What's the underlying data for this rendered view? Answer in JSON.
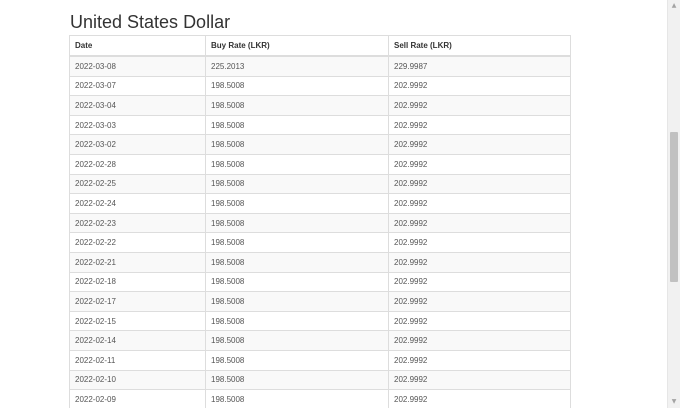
{
  "page": {
    "title": "United States Dollar"
  },
  "table": {
    "headers": [
      "Date",
      "Buy Rate (LKR)",
      "Sell Rate (LKR)"
    ],
    "rows": [
      [
        "2022-03-08",
        "225.2013",
        "229.9987"
      ],
      [
        "2022-03-07",
        "198.5008",
        "202.9992"
      ],
      [
        "2022-03-04",
        "198.5008",
        "202.9992"
      ],
      [
        "2022-03-03",
        "198.5008",
        "202.9992"
      ],
      [
        "2022-03-02",
        "198.5008",
        "202.9992"
      ],
      [
        "2022-02-28",
        "198.5008",
        "202.9992"
      ],
      [
        "2022-02-25",
        "198.5008",
        "202.9992"
      ],
      [
        "2022-02-24",
        "198.5008",
        "202.9992"
      ],
      [
        "2022-02-23",
        "198.5008",
        "202.9992"
      ],
      [
        "2022-02-22",
        "198.5008",
        "202.9992"
      ],
      [
        "2022-02-21",
        "198.5008",
        "202.9992"
      ],
      [
        "2022-02-18",
        "198.5008",
        "202.9992"
      ],
      [
        "2022-02-17",
        "198.5008",
        "202.9992"
      ],
      [
        "2022-02-15",
        "198.5008",
        "202.9992"
      ],
      [
        "2022-02-14",
        "198.5008",
        "202.9992"
      ],
      [
        "2022-02-11",
        "198.5008",
        "202.9992"
      ],
      [
        "2022-02-10",
        "198.5008",
        "202.9992"
      ],
      [
        "2022-02-09",
        "198.5008",
        "202.9992"
      ]
    ]
  },
  "scrollbar": {
    "up_icon": "arrow-up-icon",
    "down_icon": "arrow-down-icon"
  }
}
